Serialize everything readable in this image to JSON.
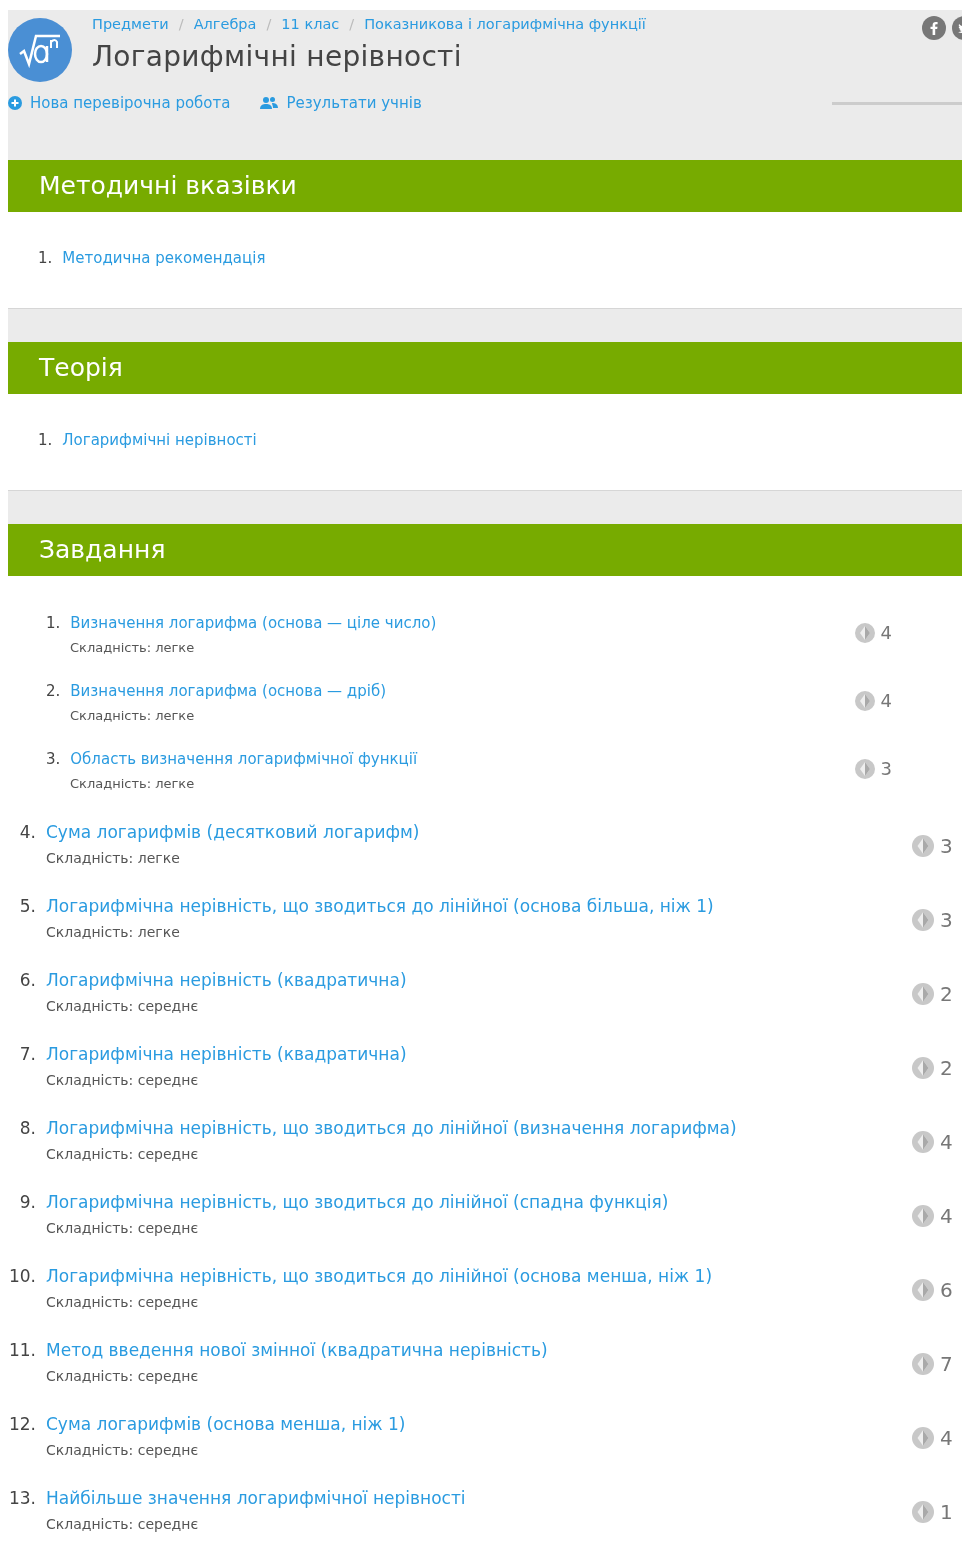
{
  "breadcrumb_separator": "/",
  "breadcrumbs": [
    "Предмети",
    "Алгебра",
    "11 клас",
    "Показникова і логарифмічна функції"
  ],
  "title": "Логарифмічні нерівності",
  "actions": [
    {
      "label": "Нова перевірочна робота",
      "kind": "add"
    },
    {
      "label": "Результати учнів",
      "kind": "users"
    }
  ],
  "sections": [
    {
      "title": "Методичні вказівки",
      "items": [
        {
          "number": "1.",
          "label": "Методична рекомендація"
        }
      ]
    },
    {
      "title": "Теорія",
      "items": [
        {
          "number": "1.",
          "label": "Логарифмічні нерівності"
        }
      ]
    }
  ],
  "tasks_section": {
    "title": "Завдання",
    "tasks": [
      {
        "number": "1.",
        "label": "Визначення логарифма (основа — ціле число)",
        "difficulty": "Складність: легке",
        "points": "4"
      },
      {
        "number": "2.",
        "label": "Визначення логарифма (основа — дріб)",
        "difficulty": "Складність: легке",
        "points": "4"
      },
      {
        "number": "3.",
        "label": "Область визначення логарифмічної функції",
        "difficulty": "Складність: легке",
        "points": "3"
      }
    ],
    "more_tasks": [
      {
        "number": "4.",
        "label": "Сума логарифмів (десятковий логарифм)",
        "difficulty": "Складність: легке",
        "points": "3"
      },
      {
        "number": "5.",
        "label": "Логарифмічна нерівність, що зводиться до лінійної (основа більша, ніж 1)",
        "difficulty": "Складність: легке",
        "points": "3"
      },
      {
        "number": "6.",
        "label": "Логарифмічна нерівність (квадратична)",
        "difficulty": "Складність: середнє",
        "points": "2"
      },
      {
        "number": "7.",
        "label": "Логарифмічна нерівність (квадратична)",
        "difficulty": "Складність: середнє",
        "points": "2"
      },
      {
        "number": "8.",
        "label": "Логарифмічна нерівність, що зводиться до лінійної (визначення логарифма)",
        "difficulty": "Складність: середнє",
        "points": "4"
      },
      {
        "number": "9.",
        "label": "Логарифмічна нерівність, що зводиться до лінійної (спадна функція)",
        "difficulty": "Складність: середнє",
        "points": "4"
      },
      {
        "number": "10.",
        "label": "Логарифмічна нерівність, що зводиться до лінійної (основа менша, ніж 1)",
        "difficulty": "Складність: середнє",
        "points": "6"
      },
      {
        "number": "11.",
        "label": "Метод введення нової змінної (квадратична нерівність)",
        "difficulty": "Складність: середнє",
        "points": "7"
      },
      {
        "number": "12.",
        "label": "Сума логарифмів (основа менша, ніж 1)",
        "difficulty": "Складність: середнє",
        "points": "4"
      },
      {
        "number": "13.",
        "label": "Найбільше значення логарифмічної нерівності",
        "difficulty": "Складність: середнє",
        "points": "1"
      }
    ]
  }
}
